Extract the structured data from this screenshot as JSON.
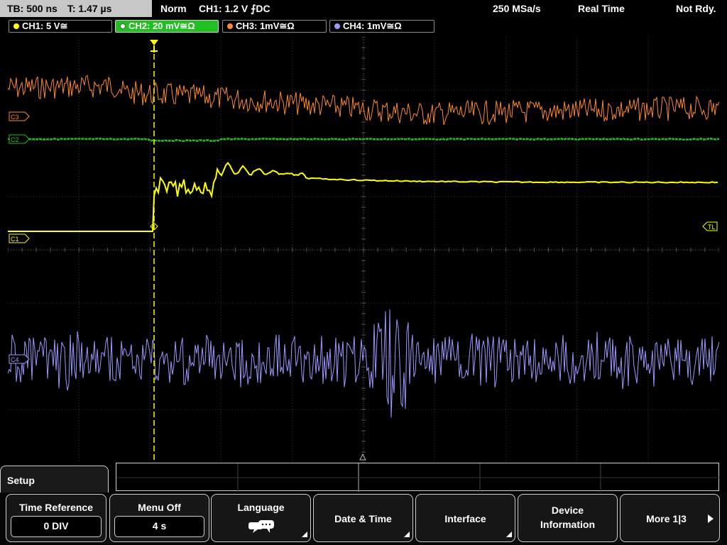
{
  "status_bar": {
    "timebase": "TB: 500 ns",
    "trigger_time": "T: 1.47 µs",
    "trigger_mode": "Norm",
    "trigger_info": "CH1: 1.2 V ⨍DC",
    "sample_rate": "250 MSa/s",
    "acq_mode": "Real Time",
    "state": "Not Rdy."
  },
  "channels": [
    {
      "label": "CH1: 5 V≅",
      "color": "#ffff00",
      "active": false
    },
    {
      "label": "CH2: 20 mV≅Ω",
      "color": "#21c021",
      "active": true
    },
    {
      "label": "CH3: 1mV≅Ω",
      "color": "#ff8a2a",
      "active": false
    },
    {
      "label": "CH4: 1mV≅Ω",
      "color": "#9a9aff",
      "active": false
    }
  ],
  "markers": {
    "c3": "C3",
    "c2": "C2",
    "c1": "C1",
    "c4": "C4",
    "tl": "TL"
  },
  "menu": {
    "title": "Setup",
    "softkeys": [
      {
        "label": "Time Reference",
        "value": "0 DIV",
        "icon": ""
      },
      {
        "label": "Menu Off",
        "value": "4 s",
        "icon": ""
      },
      {
        "label": "Language",
        "value": "",
        "icon": "speech-bubbles-icon"
      },
      {
        "label": "Date & Time",
        "value": "",
        "icon": ""
      },
      {
        "label": "Interface",
        "value": "",
        "icon": ""
      },
      {
        "label": "Device\nInformation",
        "value": "",
        "icon": ""
      },
      {
        "label": "More 1|3",
        "value": "",
        "icon": "play-arrow-icon"
      }
    ]
  },
  "colors": {
    "ch1": "#ffff00",
    "ch2": "#21c021",
    "ch3": "#ff8a2a",
    "ch4": "#9a9aff",
    "grid": "#3a3a3a"
  }
}
